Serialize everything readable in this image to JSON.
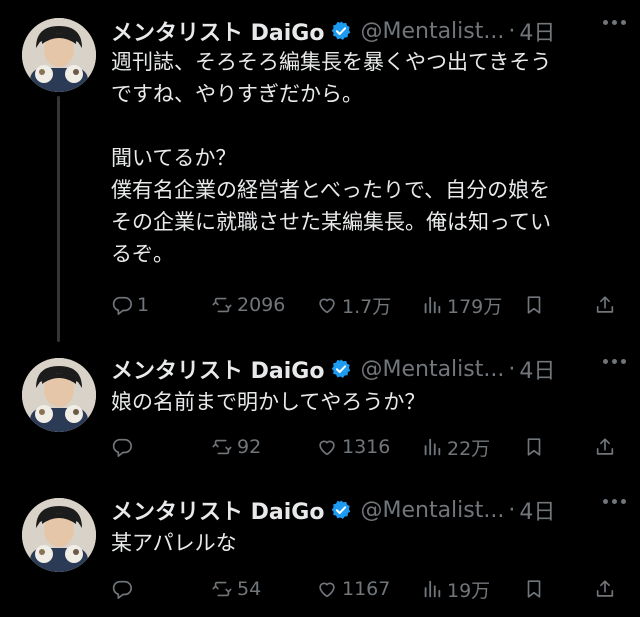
{
  "tweets": [
    {
      "name": "メンタリスト DaiGo",
      "handle": "@Mentalist...",
      "dot": "·",
      "time": "4日",
      "text": "週刊誌、そろそろ編集長を暴くやつ出てきそう\nですね、やりすぎだから。\n\n聞いてるか？\n僕有名企業の経営者とべったりで、自分の娘を\nその企業に就職させた某編集長。俺は知ってい\nるぞ。",
      "replies": "1",
      "retweets": "2096",
      "likes": "1.7万",
      "views": "179万"
    },
    {
      "name": "メンタリスト DaiGo",
      "handle": "@Mentalist...",
      "dot": "·",
      "time": "4日",
      "text": "娘の名前まで明かしてやろうか？",
      "replies": "",
      "retweets": "92",
      "likes": "1316",
      "views": "22万"
    },
    {
      "name": "メンタリスト DaiGo",
      "handle": "@Mentalist...",
      "dot": "·",
      "time": "4日",
      "text": "某アパレルな",
      "replies": "",
      "retweets": "54",
      "likes": "1167",
      "views": "19万"
    }
  ],
  "colors": {
    "background": "#000000",
    "text": "#e7e9ea",
    "muted": "#71767b",
    "verified": "#1d9bf0",
    "thread_line": "#333639"
  },
  "icons": [
    "reply-icon",
    "retweet-icon",
    "like-icon",
    "views-icon",
    "bookmark-icon",
    "share-icon",
    "verified-badge-icon",
    "more-icon"
  ]
}
